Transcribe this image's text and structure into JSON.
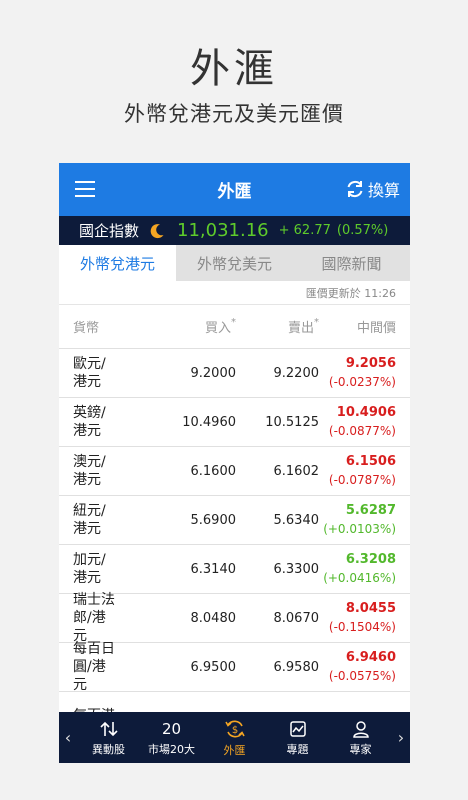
{
  "promo": {
    "title": "外滙",
    "subtitle": "外幣兌港元及美元匯價"
  },
  "appbar": {
    "title": "外匯",
    "convert_label": "換算"
  },
  "index": {
    "name": "國企指數",
    "value": "11,031.16",
    "change": "+ 62.77",
    "percent": "(0.57%)"
  },
  "tabs": [
    {
      "label": "外幣兌港元"
    },
    {
      "label": "外幣兌美元"
    },
    {
      "label": "國際新聞"
    }
  ],
  "update_time": "匯價更新於 11:26",
  "table": {
    "headers": {
      "name": "貨幣",
      "buy": "買入",
      "sell": "賣出",
      "mid": "中間價",
      "star": "*"
    },
    "rows": [
      {
        "name": "歐元/港元",
        "buy": "9.2000",
        "sell": "9.2200",
        "mid": "9.2056",
        "change": "(-0.0237%)",
        "dir": "down"
      },
      {
        "name": "英鎊/港元",
        "buy": "10.4960",
        "sell": "10.5125",
        "mid": "10.4906",
        "change": "(-0.0877%)",
        "dir": "down"
      },
      {
        "name": "澳元/港元",
        "buy": "6.1600",
        "sell": "6.1602",
        "mid": "6.1506",
        "change": "(-0.0787%)",
        "dir": "down"
      },
      {
        "name": "紐元/港元",
        "buy": "5.6900",
        "sell": "5.6340",
        "mid": "5.6287",
        "change": "(+0.0103%)",
        "dir": "up"
      },
      {
        "name": "加元/港元",
        "buy": "6.3140",
        "sell": "6.3300",
        "mid": "6.3208",
        "change": "(+0.0416%)",
        "dir": "up"
      },
      {
        "name": "瑞士法郎/港元",
        "buy": "8.0480",
        "sell": "8.0670",
        "mid": "8.0455",
        "change": "(-0.1504%)",
        "dir": "down"
      },
      {
        "name": "每百日圓/港元",
        "buy": "6.9500",
        "sell": "6.9580",
        "mid": "6.9460",
        "change": "(-0.0575%)",
        "dir": "down"
      },
      {
        "name": "每百港",
        "buy": "",
        "sell": "",
        "mid": "",
        "change": "",
        "dir": "up"
      }
    ]
  },
  "bottom_nav": {
    "left_arrow": "‹",
    "right_arrow": "›",
    "items": [
      {
        "label": "異動股",
        "icon": "up-down-arrows-icon"
      },
      {
        "label": "市場20大",
        "icon_text": "20"
      },
      {
        "label": "外匯",
        "icon": "dollar-cycle-icon"
      },
      {
        "label": "專題",
        "icon": "chart-icon"
      },
      {
        "label": "專家",
        "icon": "person-icon"
      }
    ]
  },
  "colors": {
    "appbar": "#1e7be3",
    "navy": "#0d1b3a",
    "up": "#52b82c",
    "down": "#d81e1e",
    "active_nav": "#f5a623"
  }
}
